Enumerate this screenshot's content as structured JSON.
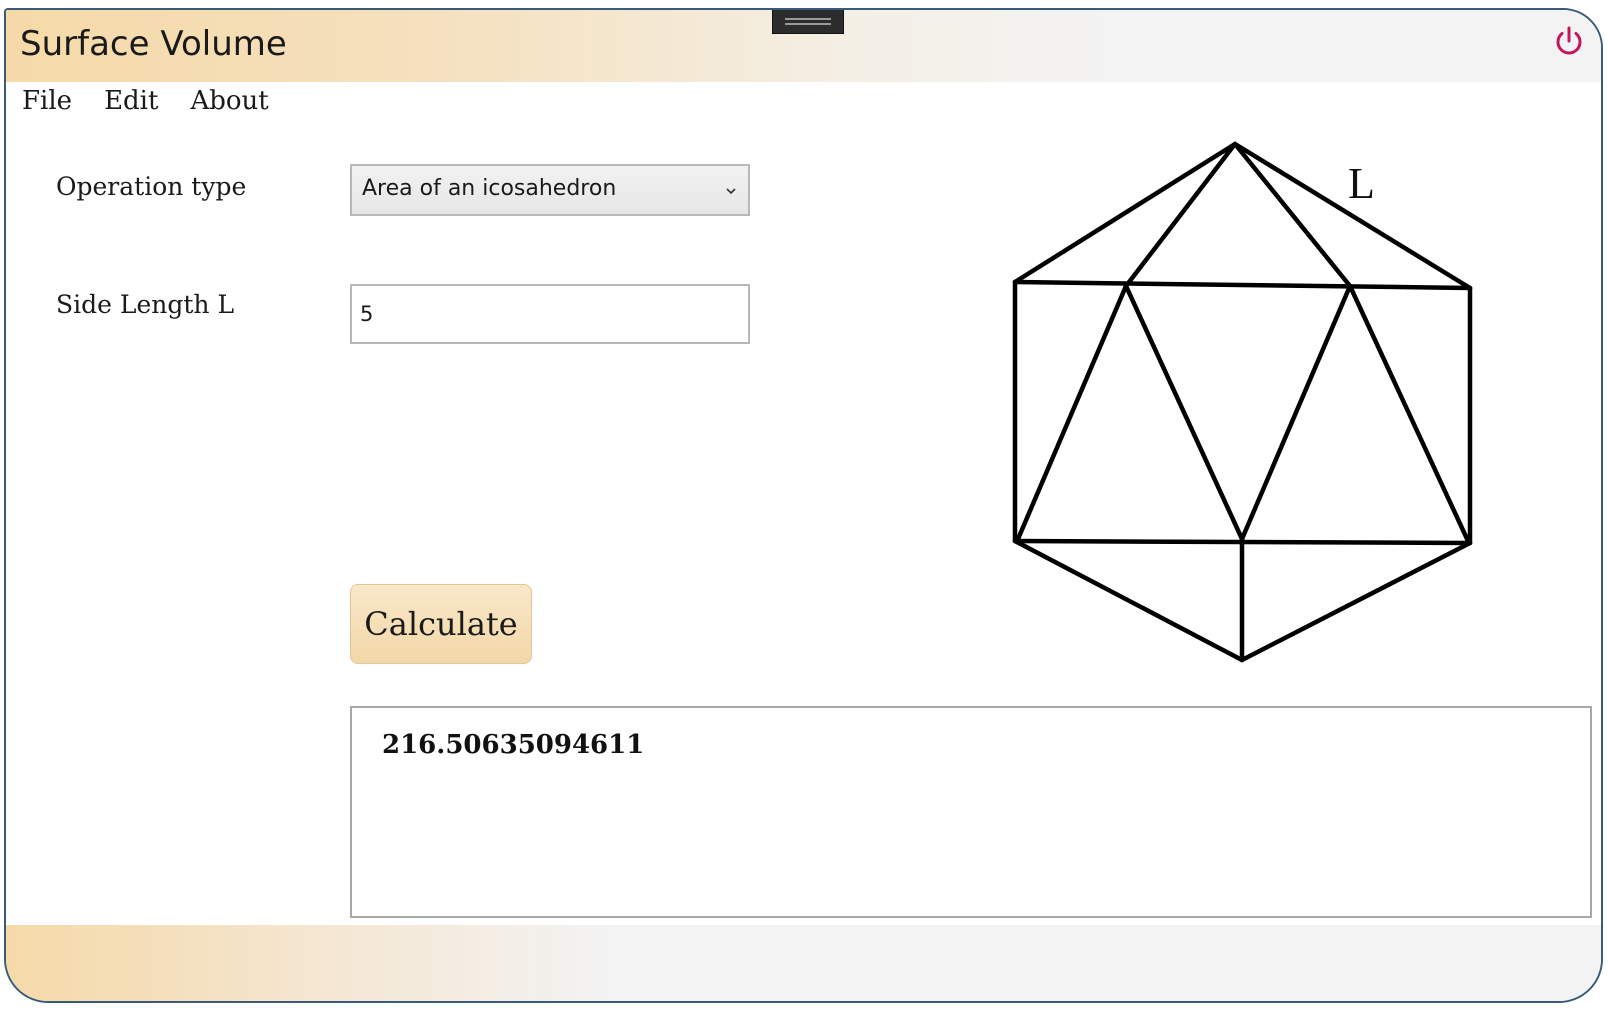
{
  "window": {
    "title": "Surface Volume",
    "accent_color": "#c2185b",
    "title_gradient_start": "#f5d9a8"
  },
  "icons": {
    "power": "power-icon",
    "chevron": "chevron-down-icon",
    "grip": "drag-handle-icon"
  },
  "menu": {
    "items": [
      "File",
      "Edit",
      "About"
    ]
  },
  "form": {
    "operation_label": "Operation type",
    "operation_value": "Area of an icosahedron",
    "side_label": "Side Length L",
    "side_value": "5",
    "calculate_label": "Calculate",
    "result": "216.50635094611"
  },
  "diagram": {
    "shape": "icosahedron",
    "edge_label": "L"
  }
}
